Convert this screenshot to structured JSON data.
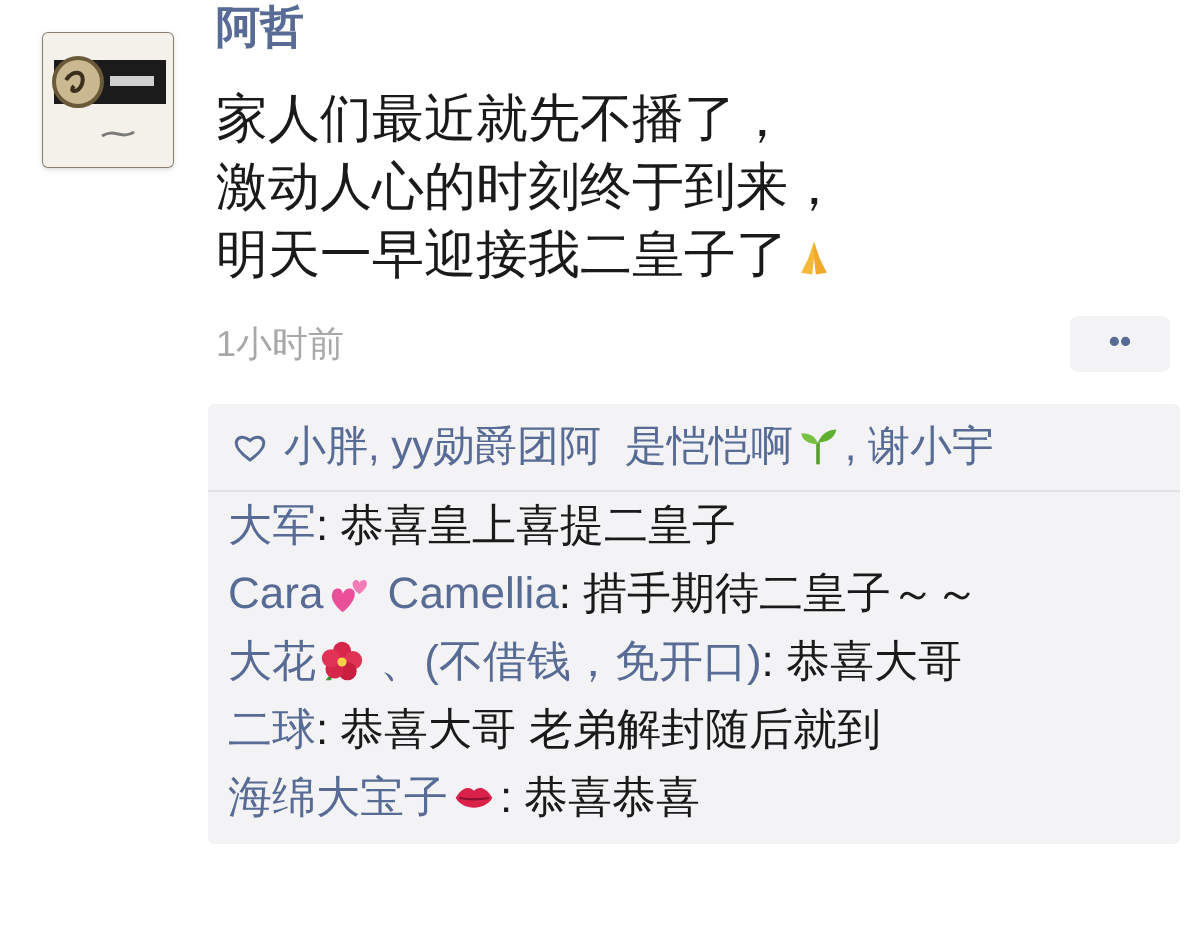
{
  "post": {
    "author": "阿哲",
    "lines": [
      {
        "text": "家人们最近就先不播了，"
      },
      {
        "text": "激动人心的时刻终于到来，"
      },
      {
        "text": "明天一早迎接我二皇子了",
        "emoji": {
          "kind": "pray"
        }
      }
    ],
    "time": "1小时前",
    "more": "••"
  },
  "likes": [
    {
      "text": "小胖, yy勋爵团阿  是恺恺啊",
      "emoji": {
        "kind": "sprout"
      }
    },
    {
      "text": ", 谢小宇"
    }
  ],
  "comments": [
    {
      "author": "大军",
      "text": ": 恭喜皇上喜提二皇子"
    },
    {
      "author": "Cara",
      "author_emoji": {
        "kind": "hearts"
      },
      "author_rest": " Camellia",
      "text": ": 措手期待二皇子～～"
    },
    {
      "author": "大花",
      "author_emoji": {
        "kind": "flower"
      },
      "author_rest": " 、(不借钱，免开口)",
      "text": ": 恭喜大哥"
    },
    {
      "author": "二球",
      "text": ": 恭喜大哥 老弟解封随后就到"
    },
    {
      "author": "海绵大宝子",
      "author_emoji": {
        "kind": "lips"
      },
      "text": ": 恭喜恭喜"
    }
  ]
}
